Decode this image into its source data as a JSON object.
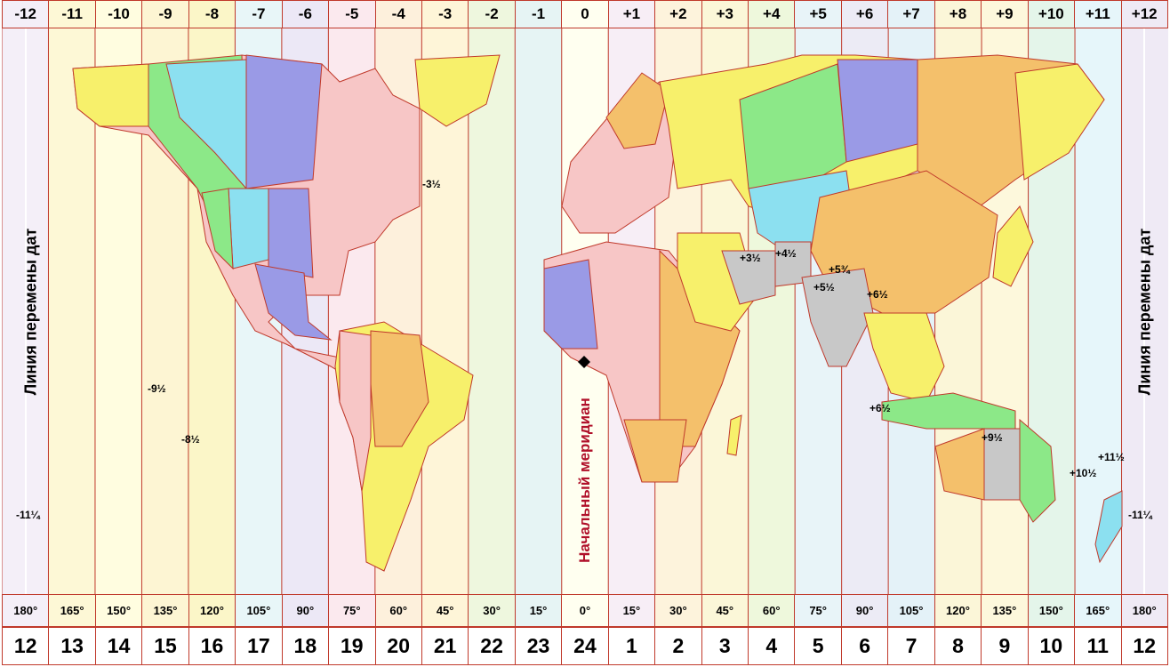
{
  "zones_top": [
    "-12",
    "-11",
    "-10",
    "-9",
    "-8",
    "-7",
    "-6",
    "-5",
    "-4",
    "-3",
    "-2",
    "-1",
    "0",
    "+1",
    "+2",
    "+3",
    "+4",
    "+5",
    "+6",
    "+7",
    "+8",
    "+9",
    "+10",
    "+11",
    "+12"
  ],
  "degrees": [
    "180°",
    "165°",
    "150°",
    "135°",
    "120°",
    "105°",
    "90°",
    "75°",
    "60°",
    "45°",
    "30°",
    "15°",
    "0°",
    "15°",
    "30°",
    "45°",
    "60°",
    "75°",
    "90°",
    "105°",
    "120°",
    "135°",
    "150°",
    "165°",
    "180°"
  ],
  "hours": [
    "12",
    "13",
    "14",
    "15",
    "16",
    "17",
    "18",
    "19",
    "20",
    "21",
    "22",
    "23",
    "24",
    "1",
    "2",
    "3",
    "4",
    "5",
    "6",
    "7",
    "8",
    "9",
    "10",
    "11",
    "12"
  ],
  "labels": {
    "date_line_left": "Линия перемены дат",
    "date_line_right": "Линия перемены дат",
    "prime_meridian": "Начальный меридиан"
  },
  "offsets": {
    "newfoundland": "-3½",
    "marquesas": "-9½",
    "pitcairn": "-8½",
    "niue_left": "-11¼",
    "niue_right": "-11¼",
    "iran": "+3½",
    "afghanistan": "+4½",
    "nepal": "+5¾",
    "india": "+5½",
    "myanmar": "+6½",
    "cocos": "+6½",
    "australia_central": "+9½",
    "lord_howe": "+10½",
    "norfolk": "+11½"
  },
  "colors": {
    "ocean_stripes": [
      "#f4eff8",
      "#fdf8d6",
      "#fffde0",
      "#fdf5d3",
      "#fbf6c8",
      "#e8f6f8",
      "#ece8f6",
      "#fbe9ee",
      "#fdf0dc",
      "#fef5d8",
      "#eef7de",
      "#e6f4f4",
      "#fffff0",
      "#f7eef6",
      "#fdf3dc",
      "#fbf7d8",
      "#eef8dc",
      "#e8f4f8",
      "#ecebf5",
      "#e4f2f8",
      "#fbf6d8",
      "#fdf8dc",
      "#e4f5ea",
      "#e6f6fa",
      "#efeaf5"
    ],
    "zone_border": "#c0392b",
    "land_yellow": "#f7f06b",
    "land_pink": "#f7c6c6",
    "land_orange": "#f4c06b",
    "land_green": "#8ce88c",
    "land_blue": "#8ce0f0",
    "land_purple": "#9a9ae6",
    "land_gray": "#c8c8c8",
    "meridian_text": "#b0102a"
  }
}
